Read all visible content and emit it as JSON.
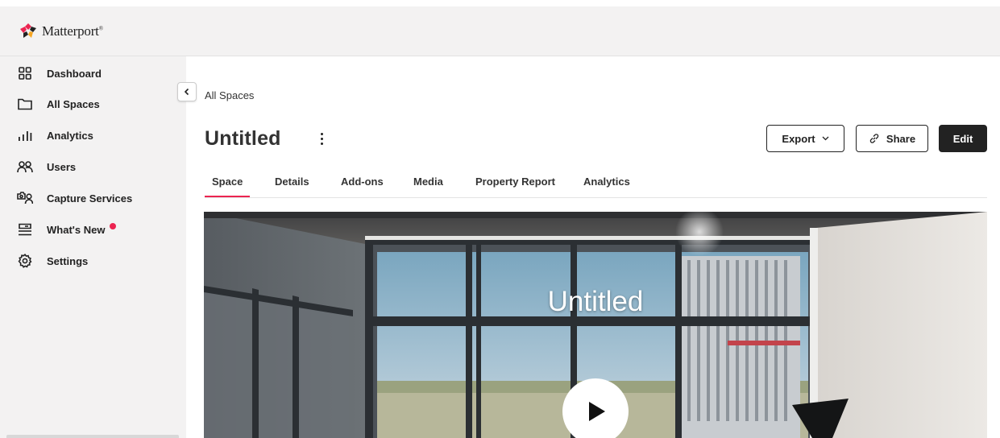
{
  "brand": {
    "name": "Matterport",
    "trademark": "®"
  },
  "sidebar": {
    "items": [
      {
        "label": "Dashboard",
        "icon": "dashboard-icon"
      },
      {
        "label": "All Spaces",
        "icon": "folder-icon"
      },
      {
        "label": "Analytics",
        "icon": "analytics-icon"
      },
      {
        "label": "Users",
        "icon": "users-icon"
      },
      {
        "label": "Capture Services",
        "icon": "capture-services-icon"
      },
      {
        "label": "What's New",
        "icon": "whats-new-icon",
        "has_notification": true
      },
      {
        "label": "Settings",
        "icon": "gear-icon"
      }
    ]
  },
  "breadcrumb": "All Spaces",
  "page": {
    "title": "Untitled"
  },
  "actions": {
    "export_label": "Export",
    "share_label": "Share",
    "edit_label": "Edit"
  },
  "tabs": [
    {
      "label": "Space",
      "active": true
    },
    {
      "label": "Details"
    },
    {
      "label": "Add-ons"
    },
    {
      "label": "Media"
    },
    {
      "label": "Property Report"
    },
    {
      "label": "Analytics"
    }
  ],
  "hero": {
    "title": "Untitled"
  },
  "colors": {
    "accent": "#ec2451",
    "sidebar_bg": "#f3f2f2",
    "primary_button": "#222222"
  }
}
